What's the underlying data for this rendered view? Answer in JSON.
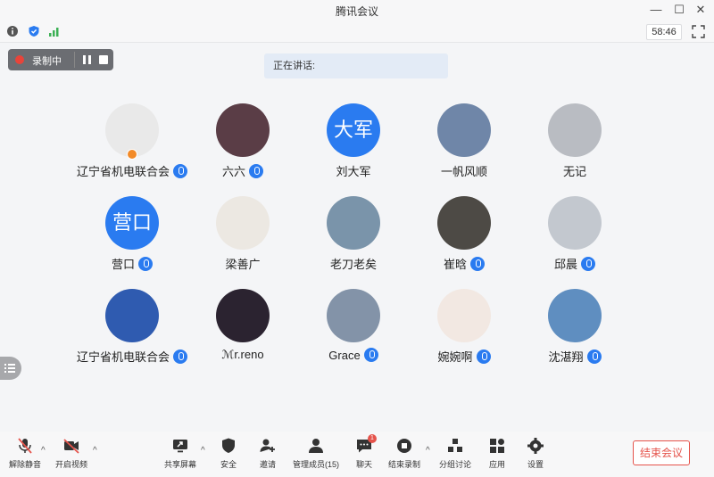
{
  "window": {
    "title": "腾讯会议"
  },
  "infobar": {
    "timer": "58:46"
  },
  "recording": {
    "label": "录制中"
  },
  "speaking": {
    "label": "正在讲话:"
  },
  "participants": [
    {
      "name": "辽宁省机电联合会",
      "mic": true,
      "host": true,
      "avatar_text": "",
      "avatar_color": "#e9e9e9"
    },
    {
      "name": "六六",
      "mic": true,
      "avatar_text": "",
      "avatar_color": "#5a3d46"
    },
    {
      "name": "刘大军",
      "mic": false,
      "avatar_text": "大军",
      "avatar_color": "#2a7bf0"
    },
    {
      "name": "一帆风顺",
      "mic": false,
      "avatar_text": "",
      "avatar_color": "#6f86a8"
    },
    {
      "name": "无记",
      "mic": false,
      "avatar_text": "",
      "avatar_color": "#b9bcc2"
    },
    {
      "name": "营口",
      "mic": true,
      "avatar_text": "营口",
      "avatar_color": "#2a7bf0"
    },
    {
      "name": "梁善广",
      "mic": false,
      "avatar_text": "",
      "avatar_color": "#ece8e2"
    },
    {
      "name": "老刀老矣",
      "mic": false,
      "avatar_text": "",
      "avatar_color": "#7a94aa"
    },
    {
      "name": "崔晗",
      "mic": true,
      "avatar_text": "",
      "avatar_color": "#4d4a45"
    },
    {
      "name": "邱晨",
      "mic": true,
      "avatar_text": "",
      "avatar_color": "#c3c8cf"
    },
    {
      "name": "辽宁省机电联合会",
      "mic": true,
      "avatar_text": "",
      "avatar_color": "#2f5bb0"
    },
    {
      "name": "ℳr.reno",
      "mic": false,
      "avatar_text": "",
      "avatar_color": "#2b2330"
    },
    {
      "name": "Grace",
      "mic": true,
      "avatar_text": "",
      "avatar_color": "#8393a8"
    },
    {
      "name": "婉婉啊",
      "mic": true,
      "avatar_text": "",
      "avatar_color": "#f2e8e2"
    },
    {
      "name": "沈湛翔",
      "mic": true,
      "avatar_text": "",
      "avatar_color": "#5f8ec0"
    }
  ],
  "toolbar": {
    "unmute": "解除静音",
    "video": "开启视频",
    "share": "共享屏幕",
    "security": "安全",
    "invite": "邀请",
    "members": "管理成员(15)",
    "chat": "聊天",
    "chat_badge": "1",
    "end_record": "结束录制",
    "breakout": "分组讨论",
    "apps": "应用",
    "settings": "设置",
    "end_meeting": "结束会议"
  },
  "colors": {
    "accent": "#2a7bf0",
    "danger": "#e5534b"
  }
}
